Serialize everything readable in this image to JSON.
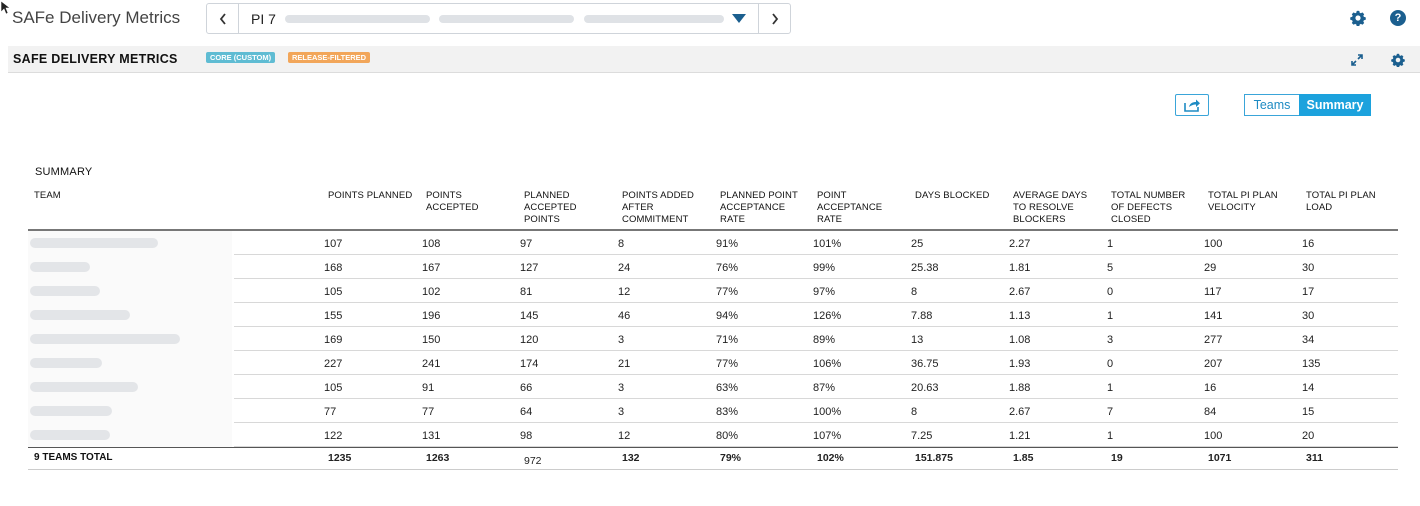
{
  "app": {
    "title": "SAFe Delivery Metrics",
    "pi_value": "PI 7",
    "accent": "#1ca2dd",
    "icon_primary": "#1b5f8f"
  },
  "panel": {
    "title": "SAFE DELIVERY METRICS",
    "tags": [
      "CORE (CUSTOM)",
      "RELEASE-FILTERED"
    ]
  },
  "controls": {
    "toggle": [
      "Teams",
      "Summary"
    ],
    "selected": "Summary"
  },
  "table": {
    "section_label": "SUMMARY",
    "columns": [
      "TEAM",
      "POINTS PLANNED",
      "POINTS ACCEPTED",
      "PLANNED ACCEPTED POINTS",
      "POINTS ADDED AFTER COMMITMENT",
      "PLANNED POINT ACCEPTANCE RATE",
      "POINT ACCEPTANCE RATE",
      "DAYS BLOCKED",
      "AVERAGE DAYS TO RESOLVE BLOCKERS",
      "TOTAL NUMBER OF DEFECTS CLOSED",
      "TOTAL PI PLAN VELOCITY",
      "TOTAL PI PLAN LOAD"
    ],
    "rows": [
      [
        "107",
        "108",
        "97",
        "8",
        "91%",
        "101%",
        "25",
        "2.27",
        "1",
        "100",
        "16"
      ],
      [
        "168",
        "167",
        "127",
        "24",
        "76%",
        "99%",
        "25.38",
        "1.81",
        "5",
        "29",
        "30"
      ],
      [
        "105",
        "102",
        "81",
        "12",
        "77%",
        "97%",
        "8",
        "2.67",
        "0",
        "117",
        "17"
      ],
      [
        "155",
        "196",
        "145",
        "46",
        "94%",
        "126%",
        "7.88",
        "1.13",
        "1",
        "141",
        "30"
      ],
      [
        "169",
        "150",
        "120",
        "3",
        "71%",
        "89%",
        "13",
        "1.08",
        "3",
        "277",
        "34"
      ],
      [
        "227",
        "241",
        "174",
        "21",
        "77%",
        "106%",
        "36.75",
        "1.93",
        "0",
        "207",
        "135"
      ],
      [
        "105",
        "91",
        "66",
        "3",
        "63%",
        "87%",
        "20.63",
        "1.88",
        "1",
        "16",
        "14"
      ],
      [
        "77",
        "77",
        "64",
        "3",
        "83%",
        "100%",
        "8",
        "2.67",
        "7",
        "84",
        "15"
      ],
      [
        "122",
        "131",
        "98",
        "12",
        "80%",
        "107%",
        "7.25",
        "1.21",
        "1",
        "100",
        "20"
      ]
    ],
    "total": {
      "label": "9 TEAMS TOTAL",
      "values": [
        "1235",
        "1263",
        "972",
        "132",
        "79%",
        "102%",
        "151.875",
        "1.85",
        "19",
        "1071",
        "311"
      ]
    }
  }
}
